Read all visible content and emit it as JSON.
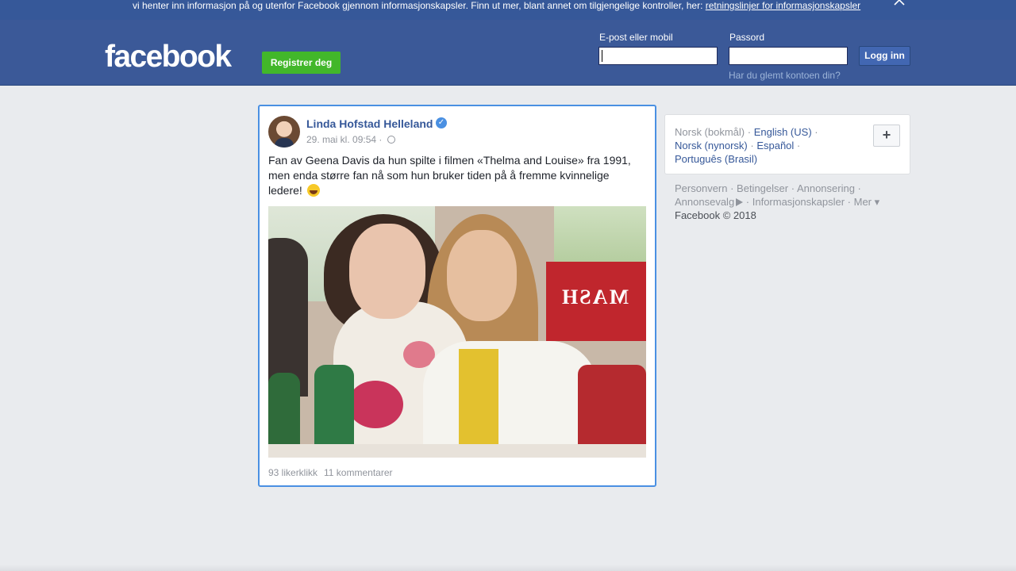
{
  "cookie_banner": {
    "text": "vi henter inn informasjon på og utenfor Facebook gjennom informasjonskapsler. Finn ut mer, blant annet om tilgjengelige kontroller, her: ",
    "link": "retningslinjer for informasjonskapsler",
    "close_icon": "close-icon"
  },
  "header": {
    "logo": "facebook",
    "register_label": "Registrer deg",
    "email_label": "E-post eller mobil",
    "email_value": "",
    "password_label": "Passord",
    "password_value": "",
    "login_label": "Logg inn",
    "forgot_link": "Har du glemt kontoen din?",
    "brand_color": "#3b5998",
    "register_color": "#42b72a"
  },
  "post": {
    "author": "Linda Hofstad Helleland",
    "verified_icon": "verified-badge-icon",
    "timestamp": "29. mai kl. 09:54",
    "meta_separator": " · ",
    "privacy_icon": "globe-icon",
    "text": "Fan av Geena Davis da hun spilte i filmen «Thelma and Louise» fra 1991, men enda større fan nå som hun bruker tiden på å fremme kvinnelige ledere!",
    "emoji_icon": "laughing-emoji-icon",
    "photo_sign": "MASH",
    "likes": "93 likerklikk",
    "comments": "11 kommentarer"
  },
  "languages": {
    "current": "Norsk (bokmål)",
    "options": [
      "English (US)",
      "Norsk (nynorsk)",
      "Español",
      "Português (Brasil)"
    ],
    "more_icon": "plus-icon"
  },
  "footer": {
    "links": [
      "Personvern",
      "Betingelser",
      "Annonsering",
      "Annonsevalg",
      "Informasjonskapsler",
      "Mer"
    ],
    "copyright": "Facebook © 2018"
  }
}
